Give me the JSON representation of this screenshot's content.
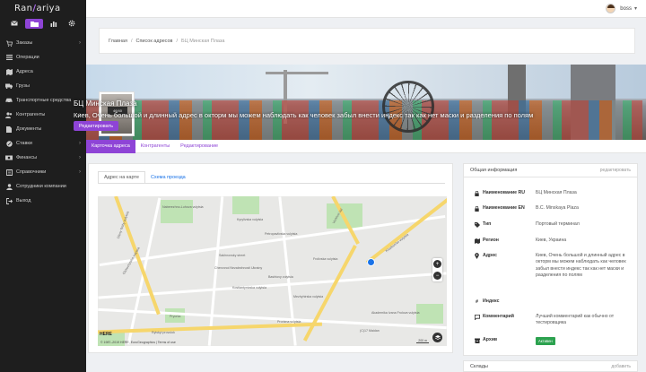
{
  "app": {
    "logo_left": "Ran",
    "logo_slash": "/",
    "logo_right": "ariya"
  },
  "sidebar": {
    "tabs": [
      "mail-icon",
      "folder-icon",
      "chart-icon",
      "gear-icon"
    ],
    "items": [
      {
        "label": "Заказы",
        "icon": "cart-icon",
        "has_children": true
      },
      {
        "label": "Операции",
        "icon": "list-icon",
        "has_children": false
      },
      {
        "label": "Адреса",
        "icon": "map-icon",
        "has_children": false
      },
      {
        "label": "Грузы",
        "icon": "truck-icon",
        "has_children": false
      },
      {
        "label": "Транспортные средства",
        "icon": "car-icon",
        "has_children": false
      },
      {
        "label": "Контрагенты",
        "icon": "users-icon",
        "has_children": true
      },
      {
        "label": "Документы",
        "icon": "document-icon",
        "has_children": true
      },
      {
        "label": "Ставки",
        "icon": "percent-icon",
        "has_children": true
      },
      {
        "label": "Финансы",
        "icon": "money-icon",
        "has_children": true
      },
      {
        "label": "Справочники",
        "icon": "book-icon",
        "has_children": true
      },
      {
        "label": "Сотрудники компании",
        "icon": "staff-icon",
        "has_children": false
      },
      {
        "label": "Выход",
        "icon": "logout-icon",
        "has_children": false
      }
    ],
    "chevron": "›"
  },
  "topbar": {
    "username": "boss",
    "caret": "▾"
  },
  "breadcrumb": {
    "items": [
      "Главная",
      "Список адресов",
      "БЦ Минская Плаза"
    ],
    "separator": "/"
  },
  "banner": {
    "photo_sign": "46/40",
    "title": "БЦ Минская Плаза",
    "address": "Киев, Очень большой и длинный адрес в окторм мы можем наблюдать как человек забыл внести индекс так как нет маски и разделения по полям",
    "edit_button": "Редактировать"
  },
  "tabs": [
    "Карточка адреса",
    "Контрагенты",
    "Редактирование"
  ],
  "map_card": {
    "tabs": [
      "Адрес на карте",
      "Схема проезда"
    ],
    "labels": [
      "Naberezhno-Luhova vulytsia",
      "Oleny Telihy vulytsia",
      "Kyrylivska vulytsia",
      "Petropavlivska vulytsia",
      "Sakhnovsky street",
      "Bashtovy vulytsia",
      "Kostiantynivska vulytsia",
      "Chervonoi Nezalezhnosti Ukrainy",
      "Mezhyhirska vulytsia",
      "Kharkivs'ke vulytsia",
      "Glybochytska vulytsia",
      "Pryorka",
      "Prorizna vulytsia",
      "Verkhnii Val",
      "(C)17 Maidan",
      "Frolivska vulytsia",
      "Akademika Ivana Frolova vulytsia",
      "Rylskyi provulok"
    ],
    "zoom_in": "+",
    "zoom_out": "−",
    "provider": "HERE",
    "copyright": "© 1987–2019 HERE, EuroGeographics | Terms of use",
    "scale": "200 m"
  },
  "info": {
    "title": "Общая информация",
    "action": "редактировать",
    "rows": [
      {
        "key": "Наименование RU",
        "value": "БЦ Минская Плаза",
        "icon": "lock-icon"
      },
      {
        "key": "Наименование EN",
        "value": "B.C. Minskaya Plaza",
        "icon": "lock-icon"
      },
      {
        "key": "Тип",
        "value": "Портовый терминал",
        "icon": "tag-icon"
      },
      {
        "key": "Регион",
        "value": "Киев, Украина",
        "icon": "map-icon"
      },
      {
        "key": "Адрес",
        "value": "Киев, Очень большой и длинный адрес в окторм мы можем наблюдать как человек забыл внести индекс так как нет маски и разделения по полям",
        "icon": "pin-icon"
      },
      {
        "key": "Индекс",
        "value": "",
        "icon": "hash-icon"
      },
      {
        "key": "Комментарий",
        "value": "Лучший комментарий как обычно от тестировщика",
        "icon": "comment-icon"
      },
      {
        "key": "Архив",
        "value": "Активен",
        "icon": "archive-icon"
      }
    ]
  },
  "warehouses": {
    "title": "Склады",
    "action": "добавить"
  },
  "colors": {
    "accent": "#8e44d6",
    "sidebar_bg": "#1e1e1e",
    "active_badge": "#2ca24f",
    "link": "#1a73e8"
  }
}
